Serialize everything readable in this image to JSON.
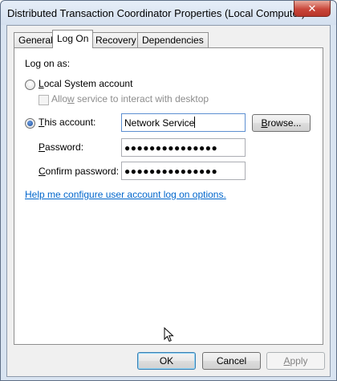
{
  "window": {
    "title": "Distributed Transaction Coordinator Properties (Local Computer)",
    "close_glyph": "✕"
  },
  "tabs": [
    {
      "label": "General",
      "active": false
    },
    {
      "label": "Log On",
      "active": true
    },
    {
      "label": "Recovery",
      "active": false
    },
    {
      "label": "Dependencies",
      "active": false
    }
  ],
  "logon": {
    "heading": "Log on as:",
    "local_system_prefix": "L",
    "local_system_rest": "ocal System account",
    "allow_service_prefix": "Allo",
    "allow_service_underlined": "w",
    "allow_service_rest": " service to interact with desktop",
    "this_account_prefix": "",
    "this_account_underlined": "T",
    "this_account_rest": "his account:",
    "account_value": "Network Service",
    "browse_prefix": "",
    "browse_underlined": "B",
    "browse_rest": "rowse...",
    "password_prefix": "",
    "password_underlined": "P",
    "password_rest": "assword:",
    "password_mask": "●●●●●●●●●●●●●●●",
    "confirm_prefix": "",
    "confirm_underlined": "C",
    "confirm_rest": "onfirm password:",
    "confirm_mask": "●●●●●●●●●●●●●●●",
    "help_link": "Help me configure user account log on options.",
    "selected_option": "This account"
  },
  "footer": {
    "ok_label": "OK",
    "cancel_label": "Cancel",
    "apply_prefix": "",
    "apply_underlined": "A",
    "apply_rest": "pply"
  },
  "colors": {
    "link": "#0066cc",
    "radio_selected": "#1c4f9c",
    "close_button": "#c9463a"
  }
}
